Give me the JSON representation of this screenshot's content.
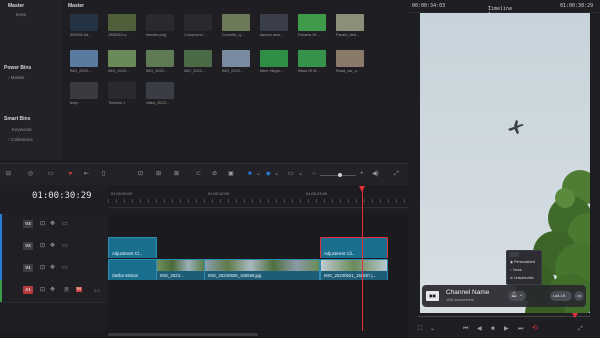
{
  "sidebar": {
    "master_label": "Master",
    "items": [
      "temp"
    ],
    "power_bins_label": "Power Bins",
    "power_bins_items": [
      "Master"
    ],
    "smart_bins_label": "Smart Bins",
    "smart_bins_items": [
      "Keywords",
      "Collections"
    ]
  },
  "pool": {
    "header": "Master",
    "clips": [
      {
        "label": "553934-hd...",
        "color": "#243344"
      },
      {
        "label": "1958343-u...",
        "color": "#4f5f3a"
      },
      {
        "label": "blender.png",
        "color": "#2a2a2e"
      },
      {
        "label": "Compound ...",
        "color": "#2a2a2e"
      },
      {
        "label": "Corvette_q...",
        "color": "#6d7a5a"
      },
      {
        "label": "davinci reso...",
        "color": "#3a3f4a"
      },
      {
        "label": "Dreams Of ...",
        "color": "#3f9a4a"
      },
      {
        "label": "Fausto_bird...",
        "color": "#8a8f7a"
      },
      {
        "label": "IMG_2023...",
        "color": "#5a7aa0"
      },
      {
        "label": "IMG_2023...",
        "color": "#6a8a5a"
      },
      {
        "label": "IMG_2023...",
        "color": "#5f7a55"
      },
      {
        "label": "IMG_2023...",
        "color": "#4a6a48"
      },
      {
        "label": "IMG_2023...",
        "color": "#7a8aa0"
      },
      {
        "label": "Mere Hinga...",
        "color": "#2f8f45"
      },
      {
        "label": "Nana Of M...",
        "color": "#35944a"
      },
      {
        "label": "Road_car_s...",
        "color": "#8a7a6a"
      },
      {
        "label": "temp",
        "color": "#3a3a3e"
      },
      {
        "label": "Timeline 1",
        "color": "#2a2a2e"
      },
      {
        "label": "video_2023...",
        "color": "#3a3d45"
      }
    ]
  },
  "viewer": {
    "source_timecode": "00:00:34:03",
    "timeline_name": "Timeline 1",
    "record_timecode": "01:00:30:29"
  },
  "overlay": {
    "channel_name": "Channel Name",
    "subscribers": "10M subscribers",
    "menu_items": [
      "Personalised",
      "None",
      "Unsubscribe"
    ],
    "likes": "4.1K"
  },
  "timeline": {
    "timecode": "01:00:30:29",
    "ruler_marks": [
      "01:00:00:00",
      "01:00:12:00",
      "01:00:24:00"
    ],
    "tracks": [
      {
        "id": "V3",
        "color": "#3c3c42"
      },
      {
        "id": "V2",
        "color": "#3c3c42"
      },
      {
        "id": "V1",
        "color": "#3c3c42"
      },
      {
        "id": "A1",
        "color": "#b83b3b"
      }
    ],
    "a1_level": "2.0",
    "clips": {
      "v2_adjustment_a": "Adjustment Cl...",
      "v2_adjustment_b": "Adjustment Cli...",
      "v1_stellar": "Stellar Motion",
      "v1_img1": "IMG_2023...",
      "v1_img2": "IMG_20230608_150558.jpg",
      "v1_img3": "IMG_20230621_150857.j..."
    }
  },
  "colors": {
    "playhead": "#e5303c",
    "accent_blue": "#2a7bd6",
    "teal_clip": "#1b6f8e"
  }
}
